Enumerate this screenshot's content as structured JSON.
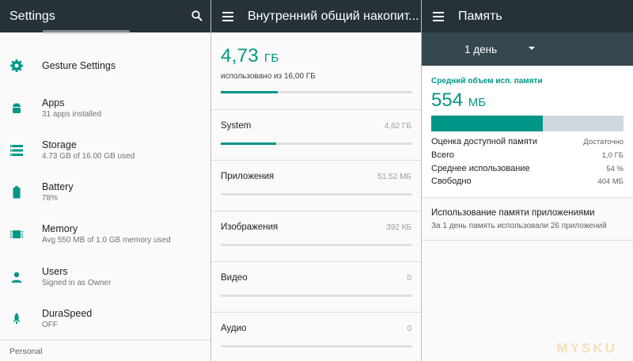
{
  "settings": {
    "title": "Settings",
    "items": [
      {
        "label": "Gesture Settings",
        "sub": "",
        "icon": "gesture-settings-icon"
      },
      {
        "label": "Apps",
        "sub": "31 apps installed",
        "icon": "apps-android-icon"
      },
      {
        "label": "Storage",
        "sub": "4.73 GB of 16.00 GB used",
        "icon": "storage-icon"
      },
      {
        "label": "Battery",
        "sub": "78%",
        "icon": "battery-icon"
      },
      {
        "label": "Memory",
        "sub": "Avg 550 MB of 1.0 GB memory used",
        "icon": "memory-chip-icon"
      },
      {
        "label": "Users",
        "sub": "Signed in as Owner",
        "icon": "user-icon"
      },
      {
        "label": "DuraSpeed",
        "sub": "OFF",
        "icon": "duraspeed-rocket-icon"
      }
    ],
    "section_label": "Personal",
    "accent": "#009688"
  },
  "storage": {
    "title": "Внутренний общий накопит...",
    "used_value": "4,73",
    "used_unit": "ГБ",
    "used_of": "использовано из 16,00 ГБ",
    "used_fraction": 0.296,
    "categories": [
      {
        "name": "System",
        "value": "4,62 ГБ",
        "fraction": 0.29
      },
      {
        "name": "Приложения",
        "value": "51,52 МБ",
        "fraction": 0
      },
      {
        "name": "Изображения",
        "value": "392 КБ",
        "fraction": 0
      },
      {
        "name": "Видео",
        "value": "0",
        "fraction": 0
      },
      {
        "name": "Аудио",
        "value": "0",
        "fraction": 0
      }
    ]
  },
  "memory": {
    "title": "Память",
    "period": "1 день",
    "avg_label": "Средний объем исп. памяти",
    "avg_value": "554",
    "avg_unit": "МБ",
    "used_fraction": 0.58,
    "stats": [
      {
        "label": "Оценка доступной памяти",
        "value": "Достаточно"
      },
      {
        "label": "Всего",
        "value": "1,0 ГБ"
      },
      {
        "label": "Среднее использование",
        "value": "54 %"
      },
      {
        "label": "Свободно",
        "value": "404 МБ"
      }
    ],
    "apps_usage_title": "Использование памяти приложениями",
    "apps_usage_sub": "За 1 день память использовали 26 приложений"
  },
  "watermark": "MYSKU"
}
